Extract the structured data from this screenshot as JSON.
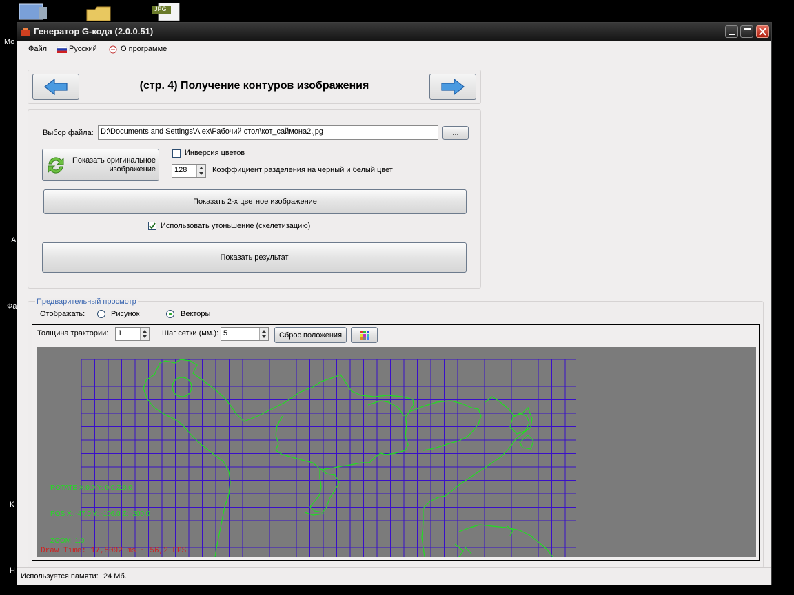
{
  "desktop": {
    "labels": [
      "Мо",
      "А",
      "Фа",
      "К",
      "Н"
    ],
    "jpg_badge": "JPG"
  },
  "window": {
    "title": "Генератор G-кода (2.0.0.51)"
  },
  "menu": {
    "file": "Файл",
    "language": "Русский",
    "about": "О программе"
  },
  "step": {
    "title": "(стр. 4) Получение контуров изображения"
  },
  "file": {
    "label": "Выбор файла:",
    "path": "D:\\Documents and Settings\\Alex\\Рабочий стол\\кот_саймона2.jpg",
    "browse": "..."
  },
  "controls": {
    "show_original": "Показать оригинальное изображение",
    "invert_colors": "Инверсия цветов",
    "threshold_value": "128",
    "threshold_label": "Коэффициент разделения на черный и белый цвет",
    "show_bw": "Показать 2-х цветное изображение",
    "use_thinning": "Использовать утоньшение (скелетизацию)",
    "use_thinning_checked": true,
    "show_result": "Показать результат"
  },
  "preview": {
    "group_title": "Предварительный просмотр",
    "display_label": "Отображать:",
    "option_picture": "Рисунок",
    "option_vectors": "Векторы",
    "selected": "vectors",
    "path_thickness_label": "Толщина трактории:",
    "path_thickness_value": "1",
    "grid_step_label": "Шаг сетки (мм.):",
    "grid_step_value": "5",
    "reset_position": "Сброс положения"
  },
  "viewport": {
    "rotate": "ROTATE X:0,0  Y: 0,0 Z:0,0",
    "pos": "POS X: -47,0  Y: -106,0 Z: -200,0",
    "zoom": "ZOOM: 1,0",
    "draw_time": "Draw Time: 17,8092 ms ~ 56,2 FPS",
    "grid_color": "#3a10c8",
    "vector_color": "#22dd22",
    "background": "#7b7b7b"
  },
  "status": {
    "memory_label": "Используется памяти:",
    "memory_value": "24 Мб."
  }
}
